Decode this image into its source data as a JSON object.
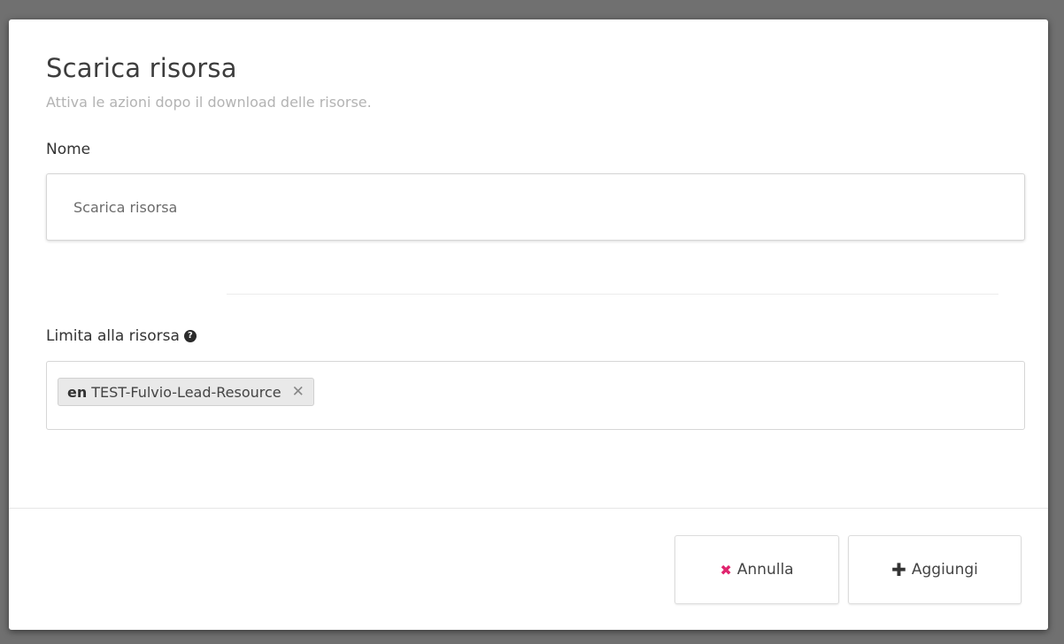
{
  "modal": {
    "title": "Scarica risorsa",
    "subtitle": "Attiva le azioni dopo il download delle risorse."
  },
  "form": {
    "name_label": "Nome",
    "name_value": "Scarica risorsa",
    "limit_label": "Limita alla risorsa",
    "help_icon": "question-circle-icon",
    "help_glyph": "?",
    "selected_resources": [
      {
        "language": "en",
        "name": "TEST-Fulvio-Lead-Resource",
        "remove_glyph": "✕"
      }
    ]
  },
  "footer": {
    "cancel_label": "Annulla",
    "cancel_icon": "times-icon",
    "cancel_glyph": "✖",
    "cancel_icon_color": "#e0246e",
    "add_label": "Aggiungi",
    "add_icon": "plus-icon",
    "add_glyph": "✚"
  }
}
